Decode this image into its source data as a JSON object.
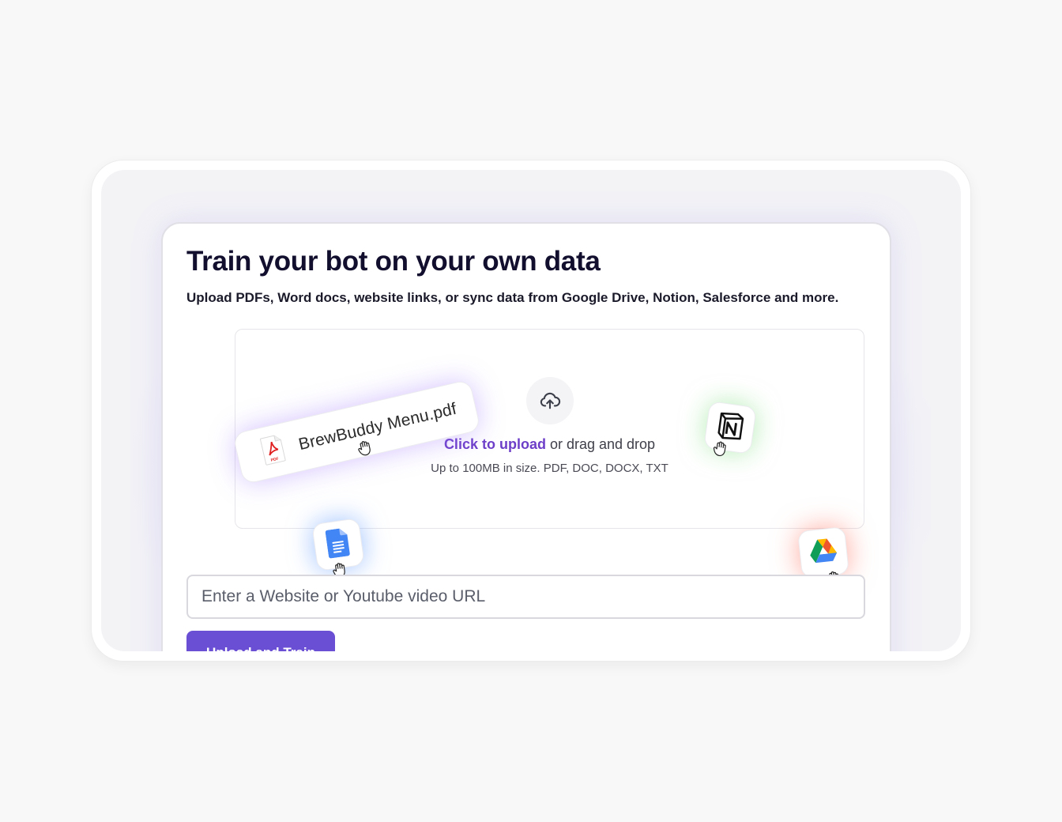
{
  "card": {
    "title": "Train your bot on your own data",
    "subtitle": "Upload PDFs, Word docs, website links, or sync data from Google Drive, Notion, Salesforce and more."
  },
  "dropzone": {
    "click_label": "Click to upload",
    "drag_label": " or drag and drop",
    "hint": "Up to 100MB in size. PDF, DOC, DOCX, TXT",
    "icon": "cloud-upload-icon"
  },
  "floating": {
    "pdf_file_name": "BrewBuddy Menu.pdf",
    "pdf_icon": "pdf-file-icon",
    "apps": [
      "notion-icon",
      "google-docs-icon",
      "google-drive-icon"
    ]
  },
  "url_input": {
    "placeholder": "Enter a Website or Youtube video URL",
    "value": ""
  },
  "actions": {
    "train_label": "Upload and Train"
  },
  "colors": {
    "accent": "#6a4fd4",
    "link": "#6d3fc8",
    "title": "#120f2e"
  }
}
